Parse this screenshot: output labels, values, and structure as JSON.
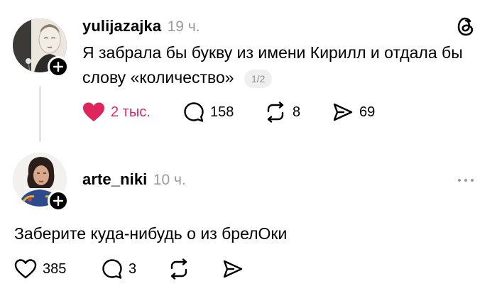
{
  "post1": {
    "username": "yulijazajka",
    "time": "19 ч.",
    "text_line1": "Я забрала бы букву из имени Кирилл и отдала бы",
    "text_line2": "слову «количество»",
    "badge": "1/2",
    "likes": "2 тыс.",
    "comments": "158",
    "reposts": "8",
    "shares": "69"
  },
  "post2": {
    "username": "arte_niki",
    "time": "10 ч.",
    "text": "Заберите куда-нибудь о из брелОки",
    "likes": "385",
    "comments": "3"
  },
  "colors": {
    "like_active": "#e0245e",
    "muted": "#9a9a9a"
  }
}
